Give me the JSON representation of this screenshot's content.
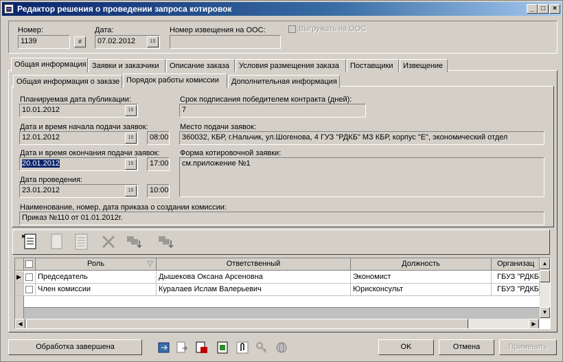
{
  "window": {
    "title": "Редактор решения о проведении запроса котировок"
  },
  "header": {
    "number_label": "Номер:",
    "number_value": "1139",
    "date_label": "Дата:",
    "date_value": "07.02.2012",
    "notice_label": "Номер извещения на ООС:",
    "notice_value": "",
    "upload_label": "Выгружать на ООС"
  },
  "tabs": [
    "Общая информация",
    "Заявки и заказчики",
    "Описание заказа",
    "Условия размещения заказа",
    "Поставщики",
    "Извещение"
  ],
  "subtabs": [
    "Общая информация о заказе",
    "Порядок работы комиссии",
    "Дополнительная информация"
  ],
  "form": {
    "pub_date_label": "Планируемая дата публикации:",
    "pub_date_value": "10.01.2012",
    "start_label": "Дата и время начала подачи заявок:",
    "start_date": "12.01.2012",
    "start_time": "08:00",
    "end_label": "Дата и время окончания подачи заявок:",
    "end_date": "20.01.2012",
    "end_time": "17:00",
    "hold_label": "Дата проведения:",
    "hold_date": "23.01.2012",
    "hold_time": "10:00",
    "term_label": "Срок подписания победителем контракта (дней):",
    "term_value": "7",
    "place_label": "Место подачи заявок:",
    "place_value": "360032, КБР, г.Нальчик, ул.Шогенова, 4 ГУЗ \"РДКБ\" МЗ КБР, корпус \"Е\", экономический отдел",
    "form_label": "Форма котировочной заявки:",
    "form_value": "см.приложение №1",
    "order_label": "Наименование, номер, дата приказа о создании комиссии:",
    "order_value": "Приказ №110 от 01.01.2012г."
  },
  "grid": {
    "columns": [
      "Роль",
      "Ответственный",
      "Должность",
      "Организац"
    ],
    "rows": [
      {
        "role": "Председатель",
        "person": "Дышекова Оксана Арсеновна",
        "position": "Экономист",
        "org": "ГБУЗ \"РДКБ"
      },
      {
        "role": "Член комиссии",
        "person": "Куралаев Ислам Валерьевич",
        "position": "Юрисконсульт",
        "org": "ГБУЗ \"РДКБ"
      }
    ]
  },
  "footer": {
    "done_label": "Обработка завершена",
    "ok_label": "OK",
    "cancel_label": "Отмена",
    "apply_label": "Применить"
  },
  "colors": {
    "title_start": "#0a246a",
    "selection": "#0a246a",
    "face": "#d4d0c8"
  }
}
